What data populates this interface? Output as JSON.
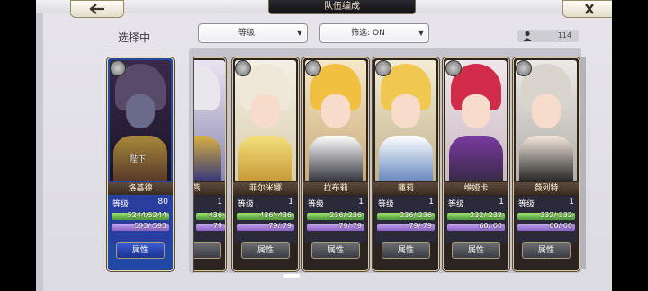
{
  "header": {
    "title": "队伍编成",
    "back_icon": "back-arrow-icon",
    "close_icon": "close-x-icon"
  },
  "selection_label": "选择中",
  "sort_dropdown": {
    "value": "等级"
  },
  "filter_dropdown": {
    "value": "筛选: ON"
  },
  "unit_count": "114",
  "attr_button_label": "属性",
  "level_label": "等级",
  "selected_card": {
    "name": "洛基德",
    "level": "80",
    "hp": "5244/5244",
    "mp": "593/ 593",
    "selected_text": "陛下",
    "colors": {
      "bg": "#2248a6"
    }
  },
  "partial_card": {
    "name": "燕",
    "level": "1",
    "hp": "436",
    "mp": "79"
  },
  "cards": [
    {
      "name": "菲尔米娜",
      "level": "1",
      "hp": "436/ 436",
      "mp": "79/ 79"
    },
    {
      "name": "拉布莉",
      "level": "1",
      "hp": "236/ 236",
      "mp": "79/ 79"
    },
    {
      "name": "蓮莉",
      "level": "1",
      "hp": "236/ 236",
      "mp": "79/ 79"
    },
    {
      "name": "维娅卡",
      "level": "1",
      "hp": "232/ 232",
      "mp": "60/ 60"
    },
    {
      "name": "薇列特",
      "level": "1",
      "hp": "332/ 332",
      "mp": "60/ 60"
    }
  ],
  "colors": {
    "accent": "#2248a6",
    "hp_bar": "#6fc04a",
    "mp_bar": "#a07ad8",
    "card_frame": "#d8c9a0"
  }
}
